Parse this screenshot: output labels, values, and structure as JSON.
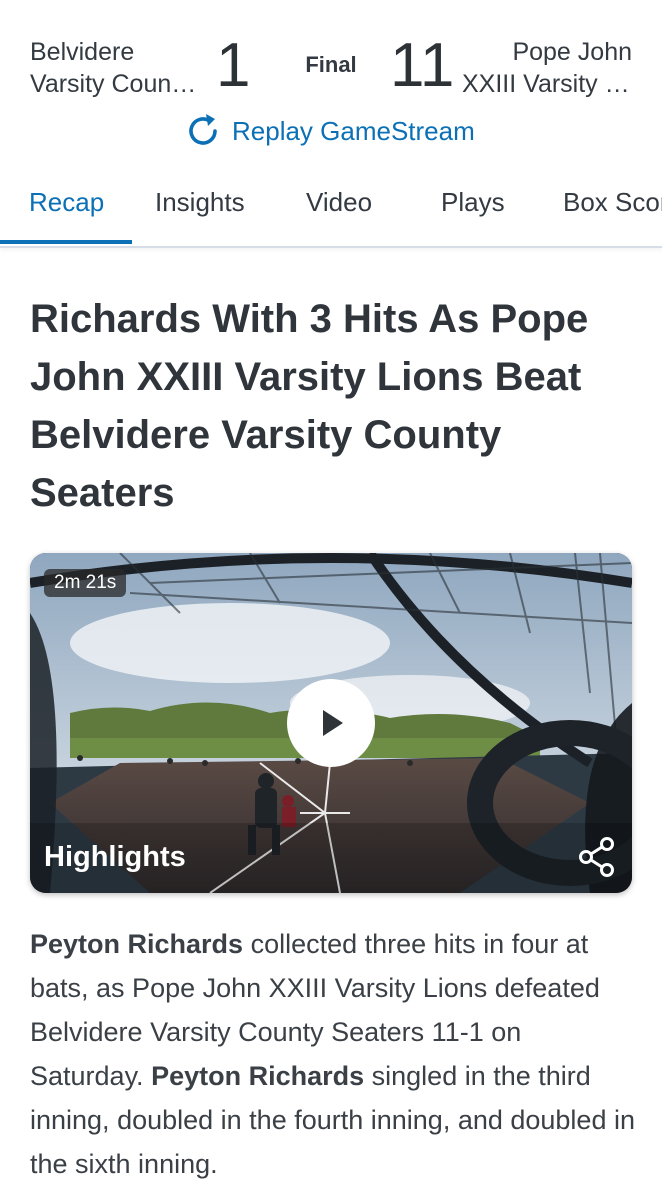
{
  "scoreboard": {
    "home_team_line1": "Belvidere",
    "home_team_line2": "Varsity County Seaters",
    "home_score": "1",
    "status": "Final",
    "away_score": "11",
    "away_team_line1": "Pope John",
    "away_team_line2": "XXIII Varsity Lions",
    "replay_label": "Replay GameStream"
  },
  "tabs": [
    {
      "label": "Recap",
      "active": true
    },
    {
      "label": "Insights"
    },
    {
      "label": "Video"
    },
    {
      "label": "Plays"
    },
    {
      "label": "Box Score"
    }
  ],
  "article": {
    "headline": "Richards With 3 Hits As Pope John XXIII Varsity Lions Beat Belvidere Varsity County Seaters",
    "video": {
      "duration": "2m 21s",
      "title": "Highlights",
      "play_icon": "play-icon",
      "share_icon": "share-icon"
    },
    "body": [
      {
        "text": "Peyton Richards",
        "bold": true
      },
      {
        "text": " collected three hits in four at bats, as Pope John XXIII Varsity Lions defeated Belvidere Varsity County Seaters 11-1 on Saturday. "
      },
      {
        "text": "Peyton Richards",
        "bold": true
      },
      {
        "text": " singled in the third inning, doubled in the fourth inning, and doubled in the sixth inning."
      }
    ]
  },
  "colors": {
    "accent": "#0b70b5",
    "text": "#333a41",
    "tab_border": "#d7dde7"
  }
}
